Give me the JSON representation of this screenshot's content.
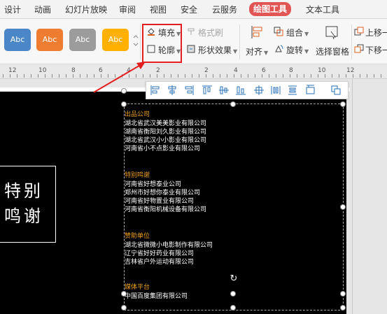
{
  "tabs": [
    "设计",
    "动画",
    "幻灯片放映",
    "审阅",
    "视图",
    "安全",
    "云服务",
    "绘图工具",
    "文本工具"
  ],
  "active_tab": "绘图工具",
  "colors": {
    "accent": "#e25555",
    "highlight_box": "#e41e1e",
    "arrow": "#e41e1e",
    "credit_heading": "#f0a020"
  },
  "ribbon": {
    "swatches": [
      {
        "label": "Abc",
        "color": "#4a86c8"
      },
      {
        "label": "Abc",
        "color": "#ef7d31"
      },
      {
        "label": "Abc",
        "color": "#9c9c9c"
      },
      {
        "label": "Abc",
        "color": "#ffb000"
      }
    ],
    "fill_label": "填充",
    "outline_label": "轮廓",
    "format_brush_label": "格式刷",
    "shape_effects_label": "形状效果",
    "align_label": "对齐",
    "group_label": "组合",
    "rotate_label": "旋转",
    "selection_pane_label": "选择窗格",
    "bring_up_label": "上移一",
    "send_down_label": "下移一"
  },
  "ruler": {
    "numbers": [
      "12",
      "10",
      "8",
      "6",
      "4",
      "2",
      "2",
      "4",
      "6",
      "8",
      "10",
      "12"
    ]
  },
  "slide": {
    "title_lines": [
      "特别",
      "鸣谢"
    ],
    "sections": [
      {
        "heading": "出品公司",
        "lines": [
          "湖北省武汉美美影业有限公司",
          "湖南省衡阳刘久影业有限公司",
          "湖北省武汉小小影业有限公司",
          "河南省小不点影业有限公司"
        ]
      },
      {
        "heading": "特别鸣谢",
        "lines": [
          "河南省好想泰业公司",
          "郑州市好想你泰业有限公司",
          "河南省好物置业有限公司",
          "河南省衡阳机械设备有限公司"
        ]
      },
      {
        "heading": "赞助单位",
        "lines": [
          "湖北省微微小电影制作有限公司",
          "辽宁省好好药业有限公司",
          "吉林省户外运动有限公司"
        ]
      },
      {
        "heading": "媒体平台",
        "lines": [
          "中国百度集团有限公司"
        ]
      }
    ]
  }
}
